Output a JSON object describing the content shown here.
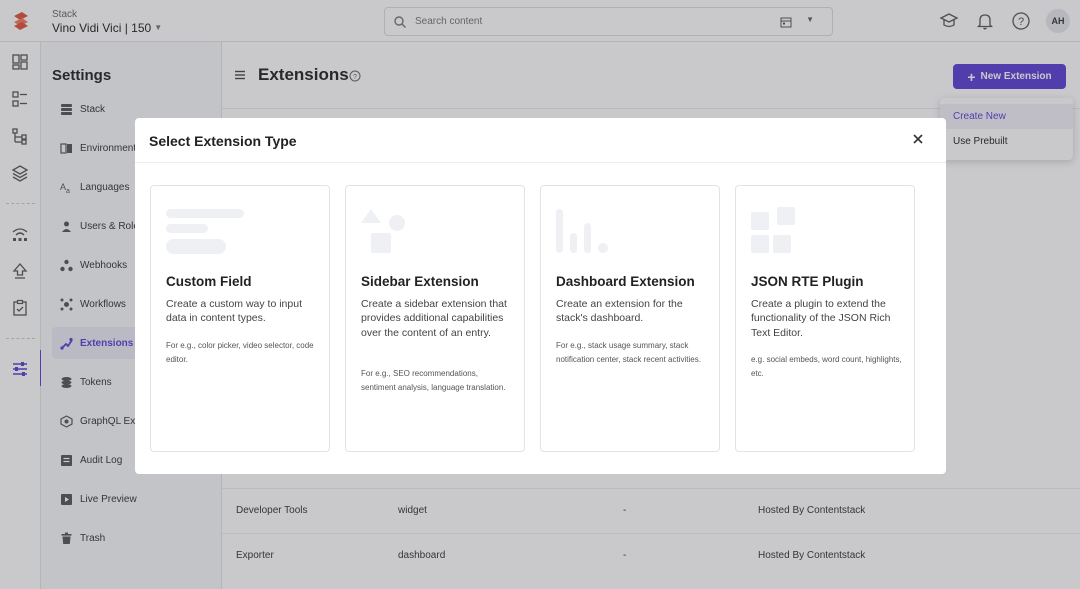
{
  "topbar": {
    "stack_label": "Stack",
    "stack_name": "Vino Vidi Vici | 150",
    "search_placeholder": "Search content",
    "avatar_initials": "AH"
  },
  "settings": {
    "title": "Settings",
    "items": [
      {
        "label": "Stack",
        "icon": "stack-icon"
      },
      {
        "label": "Environments",
        "icon": "environments-icon"
      },
      {
        "label": "Languages",
        "icon": "languages-icon"
      },
      {
        "label": "Users & Roles",
        "icon": "users-icon"
      },
      {
        "label": "Webhooks",
        "icon": "webhooks-icon"
      },
      {
        "label": "Workflows",
        "icon": "workflows-icon"
      },
      {
        "label": "Extensions",
        "icon": "extensions-icon",
        "active": true
      },
      {
        "label": "Tokens",
        "icon": "tokens-icon"
      },
      {
        "label": "GraphQL Explorer",
        "icon": "graphql-icon"
      },
      {
        "label": "Audit Log",
        "icon": "audit-log-icon"
      },
      {
        "label": "Live Preview",
        "icon": "live-preview-icon"
      },
      {
        "label": "Trash",
        "icon": "trash-icon"
      }
    ]
  },
  "main": {
    "title": "Extensions",
    "new_extension_label": "New Extension",
    "rows": [
      {
        "name": "Developer Tools",
        "type": "widget",
        "col3": "-",
        "hosting": "Hosted By Contentstack"
      },
      {
        "name": "Exporter",
        "type": "dashboard",
        "col3": "-",
        "hosting": "Hosted By Contentstack"
      }
    ]
  },
  "dropdown": {
    "items": [
      "Create New",
      "Use Prebuilt"
    ]
  },
  "modal": {
    "title": "Select Extension Type",
    "cards": [
      {
        "title": "Custom Field",
        "description": "Create a custom way to input data in content types.",
        "example": "For e.g., color picker, video selector, code editor."
      },
      {
        "title": "Sidebar Extension",
        "description": "Create a sidebar extension that provides additional capabilities over the content of an entry.",
        "example": "For e.g., SEO recommendations, sentiment analysis, language translation."
      },
      {
        "title": "Dashboard Extension",
        "description": "Create an extension for the stack's dashboard.",
        "example": "For e.g., stack usage summary, stack notification center, stack recent activities."
      },
      {
        "title": "JSON RTE Plugin",
        "description": "Create a plugin to extend the functionality of the JSON Rich Text Editor.",
        "example": "e.g. social embeds, word count, highlights, etc."
      }
    ]
  },
  "colors": {
    "accent": "#5b3ed6",
    "brand_logo": "#e0523a"
  }
}
